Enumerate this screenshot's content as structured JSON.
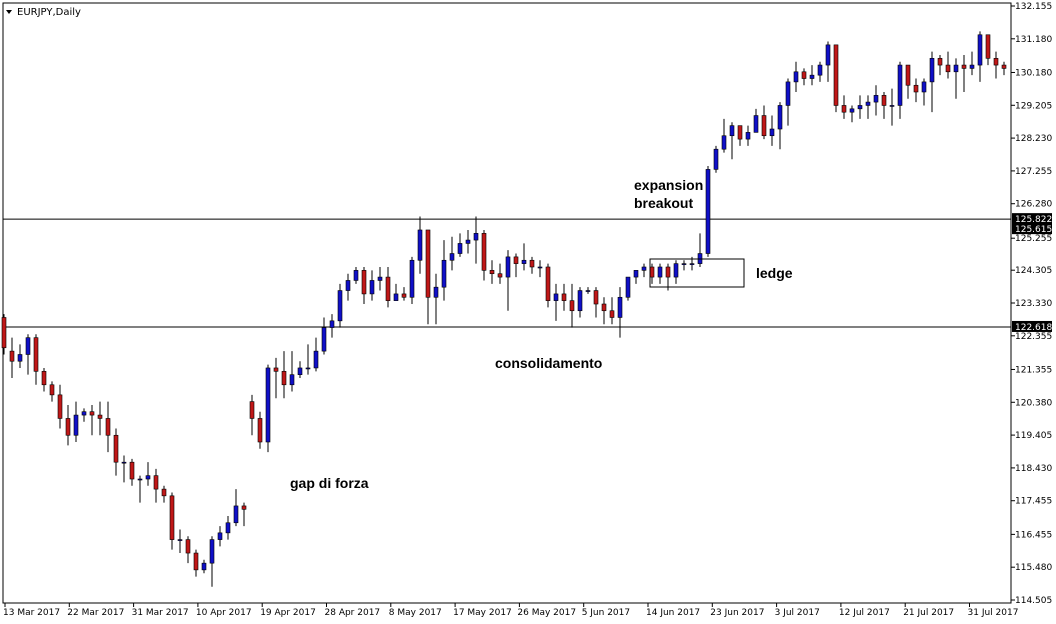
{
  "chart_data": {
    "type": "candlestick",
    "symbol": "EURJPY,Daily",
    "y_ticks": [
      "132.155",
      "131.180",
      "130.180",
      "129.205",
      "128.230",
      "127.255",
      "126.280",
      "125.255",
      "124.305",
      "123.330",
      "122.355",
      "121.355",
      "120.380",
      "119.405",
      "118.430",
      "117.455",
      "116.455",
      "115.480",
      "114.505"
    ],
    "ylim": [
      114.505,
      132.155
    ],
    "x_labels": [
      "13 Mar 2017",
      "22 Mar 2017",
      "31 Mar 2017",
      "10 Apr 2017",
      "19 Apr 2017",
      "28 Apr 2017",
      "8 May 2017",
      "17 May 2017",
      "26 May 2017",
      "5 Jun 2017",
      "14 Jun 2017",
      "23 Jun 2017",
      "3 Jul 2017",
      "12 Jul 2017",
      "21 Jul 2017",
      "31 Jul 2017"
    ],
    "levels": [
      {
        "value": 125.822,
        "label": "125.822"
      },
      {
        "value": 122.618,
        "label": "122.618"
      }
    ],
    "level_extra_label": "125.615",
    "annotations": [
      "expansion",
      "breakout",
      "ledge",
      "consolidamento",
      "gap di forza"
    ],
    "colors": {
      "up": "#1010c8",
      "down": "#c01818",
      "wick": "#000000",
      "level_bg": "#000000",
      "frame": "#000000"
    },
    "candles": [
      [
        122.9,
        122.0,
        123.0,
        121.8
      ],
      [
        121.9,
        121.6,
        122.3,
        121.1
      ],
      [
        121.6,
        121.8,
        122.1,
        121.4
      ],
      [
        121.8,
        122.3,
        122.4,
        121.2
      ],
      [
        122.3,
        121.3,
        122.4,
        120.9
      ],
      [
        121.3,
        120.9,
        121.4,
        120.7
      ],
      [
        120.9,
        120.6,
        121.0,
        120.4
      ],
      [
        120.6,
        119.9,
        120.9,
        119.6
      ],
      [
        119.9,
        119.4,
        120.3,
        119.1
      ],
      [
        119.4,
        120.0,
        120.4,
        119.2
      ],
      [
        120.0,
        120.1,
        120.2,
        119.8
      ],
      [
        120.1,
        120.0,
        120.3,
        119.4
      ],
      [
        120.0,
        119.9,
        120.4,
        119.4
      ],
      [
        119.9,
        119.4,
        120.4,
        118.9
      ],
      [
        119.4,
        118.6,
        119.6,
        118.2
      ],
      [
        118.6,
        118.6,
        118.8,
        118.0
      ],
      [
        118.6,
        118.1,
        118.7,
        117.9
      ],
      [
        118.1,
        118.1,
        118.2,
        117.4
      ],
      [
        118.1,
        118.2,
        118.6,
        117.9
      ],
      [
        118.2,
        117.8,
        118.4,
        117.4
      ],
      [
        117.8,
        117.6,
        117.9,
        117.4
      ],
      [
        117.6,
        116.3,
        117.7,
        116.0
      ],
      [
        116.3,
        116.3,
        116.6,
        115.9
      ],
      [
        116.3,
        115.9,
        116.4,
        115.6
      ],
      [
        115.9,
        115.4,
        116.0,
        115.2
      ],
      [
        115.4,
        115.6,
        115.7,
        115.3
      ],
      [
        115.6,
        116.3,
        116.4,
        114.9
      ],
      [
        116.3,
        116.5,
        116.7,
        116.1
      ],
      [
        116.5,
        116.8,
        117.0,
        116.3
      ],
      [
        116.8,
        117.3,
        117.8,
        116.7
      ],
      [
        117.3,
        117.2,
        117.4,
        116.7
      ],
      [
        120.4,
        119.9,
        120.6,
        119.4
      ],
      [
        119.9,
        119.2,
        120.1,
        119.0
      ],
      [
        119.2,
        121.4,
        121.5,
        118.9
      ],
      [
        121.4,
        121.3,
        121.7,
        120.5
      ],
      [
        121.3,
        120.9,
        121.9,
        120.5
      ],
      [
        120.9,
        121.2,
        121.9,
        120.7
      ],
      [
        121.2,
        121.4,
        121.6,
        121.1
      ],
      [
        121.4,
        121.4,
        122.1,
        121.2
      ],
      [
        121.4,
        121.9,
        122.3,
        121.3
      ],
      [
        121.9,
        122.6,
        122.9,
        121.8
      ],
      [
        122.6,
        122.8,
        123.0,
        122.3
      ],
      [
        122.8,
        123.7,
        123.9,
        122.6
      ],
      [
        123.7,
        124.0,
        124.2,
        123.4
      ],
      [
        124.0,
        124.3,
        124.4,
        123.9
      ],
      [
        124.3,
        123.6,
        124.4,
        123.3
      ],
      [
        123.6,
        124.0,
        124.3,
        123.4
      ],
      [
        124.0,
        124.1,
        124.4,
        123.7
      ],
      [
        124.1,
        123.4,
        124.4,
        123.2
      ],
      [
        123.4,
        123.6,
        123.9,
        123.4
      ],
      [
        123.6,
        123.5,
        123.8,
        123.4
      ],
      [
        123.5,
        124.6,
        124.7,
        123.3
      ],
      [
        124.6,
        125.5,
        125.9,
        124.2
      ],
      [
        125.5,
        123.5,
        125.5,
        122.7
      ],
      [
        123.5,
        123.8,
        124.2,
        122.7
      ],
      [
        123.8,
        124.6,
        125.2,
        123.4
      ],
      [
        124.6,
        124.8,
        125.3,
        124.3
      ],
      [
        124.8,
        125.1,
        125.4,
        124.7
      ],
      [
        125.1,
        125.2,
        125.5,
        124.8
      ],
      [
        125.2,
        125.4,
        125.9,
        124.5
      ],
      [
        125.4,
        124.3,
        125.5,
        124.0
      ],
      [
        124.3,
        124.2,
        124.6,
        123.9
      ],
      [
        124.2,
        124.1,
        124.5,
        123.9
      ],
      [
        124.1,
        124.7,
        124.9,
        123.1
      ],
      [
        124.7,
        124.5,
        124.8,
        124.1
      ],
      [
        124.5,
        124.6,
        125.1,
        124.3
      ],
      [
        124.6,
        124.4,
        124.7,
        124.2
      ],
      [
        124.4,
        124.4,
        124.6,
        124.1
      ],
      [
        124.4,
        123.4,
        124.5,
        123.2
      ],
      [
        123.4,
        123.6,
        123.9,
        122.8
      ],
      [
        123.6,
        123.4,
        123.9,
        123.1
      ],
      [
        123.4,
        123.1,
        123.9,
        122.6
      ],
      [
        123.1,
        123.7,
        123.8,
        122.9
      ],
      [
        123.7,
        123.7,
        123.8,
        123.6
      ],
      [
        123.7,
        123.3,
        123.8,
        122.9
      ],
      [
        123.3,
        123.1,
        123.5,
        122.7
      ],
      [
        123.1,
        122.9,
        123.5,
        122.7
      ],
      [
        122.9,
        123.5,
        123.8,
        122.3
      ],
      [
        123.5,
        124.1,
        124.1,
        123.4
      ],
      [
        124.1,
        124.3,
        124.3,
        123.9
      ],
      [
        124.3,
        124.4,
        124.5,
        124.1
      ],
      [
        124.4,
        124.1,
        124.5,
        123.9
      ],
      [
        124.1,
        124.4,
        124.5,
        123.9
      ],
      [
        124.4,
        124.1,
        124.5,
        123.7
      ],
      [
        124.1,
        124.5,
        124.6,
        123.9
      ],
      [
        124.5,
        124.5,
        124.6,
        124.3
      ],
      [
        124.5,
        124.5,
        124.7,
        124.3
      ],
      [
        124.5,
        124.8,
        125.4,
        124.4
      ],
      [
        124.8,
        127.3,
        127.4,
        124.7
      ],
      [
        127.3,
        127.9,
        128.0,
        127.2
      ],
      [
        127.9,
        128.3,
        128.8,
        127.8
      ],
      [
        128.3,
        128.6,
        128.7,
        127.6
      ],
      [
        128.6,
        128.2,
        128.5,
        128.0
      ],
      [
        128.2,
        128.4,
        128.6,
        128.0
      ],
      [
        128.4,
        128.9,
        129.1,
        128.4
      ],
      [
        128.9,
        128.3,
        129.2,
        128.2
      ],
      [
        128.3,
        128.5,
        128.9,
        128.0
      ],
      [
        128.5,
        129.2,
        129.3,
        127.9
      ],
      [
        129.2,
        129.9,
        130.0,
        128.6
      ],
      [
        129.9,
        130.2,
        130.5,
        129.6
      ],
      [
        130.2,
        130.0,
        130.3,
        129.8
      ],
      [
        130.0,
        130.1,
        130.4,
        129.8
      ],
      [
        130.1,
        130.4,
        130.5,
        129.9
      ],
      [
        130.4,
        131.0,
        131.1,
        129.9
      ],
      [
        131.0,
        129.2,
        130.7,
        129.0
      ],
      [
        129.2,
        129.0,
        129.5,
        128.8
      ],
      [
        129.0,
        129.1,
        129.2,
        128.7
      ],
      [
        129.1,
        129.2,
        129.5,
        128.8
      ],
      [
        129.2,
        129.3,
        129.5,
        128.8
      ],
      [
        129.3,
        129.5,
        129.8,
        128.9
      ],
      [
        129.5,
        129.2,
        129.6,
        128.8
      ],
      [
        129.2,
        129.2,
        129.7,
        128.6
      ],
      [
        129.2,
        130.4,
        130.5,
        128.8
      ],
      [
        130.4,
        129.8,
        130.4,
        129.4
      ],
      [
        129.8,
        129.6,
        130.0,
        129.3
      ],
      [
        129.6,
        129.9,
        130.0,
        129.2
      ],
      [
        129.9,
        130.6,
        130.8,
        129.0
      ],
      [
        130.6,
        130.4,
        130.7,
        130.1
      ],
      [
        130.4,
        130.2,
        130.8,
        130.0
      ],
      [
        130.2,
        130.4,
        130.6,
        129.4
      ],
      [
        130.4,
        130.3,
        130.7,
        129.6
      ],
      [
        130.3,
        130.4,
        130.8,
        130.1
      ],
      [
        130.4,
        131.3,
        131.4,
        129.9
      ],
      [
        131.3,
        130.6,
        131.3,
        130.4
      ],
      [
        130.6,
        130.4,
        130.8,
        130.0
      ],
      [
        130.4,
        130.3,
        130.5,
        130.1
      ]
    ]
  }
}
